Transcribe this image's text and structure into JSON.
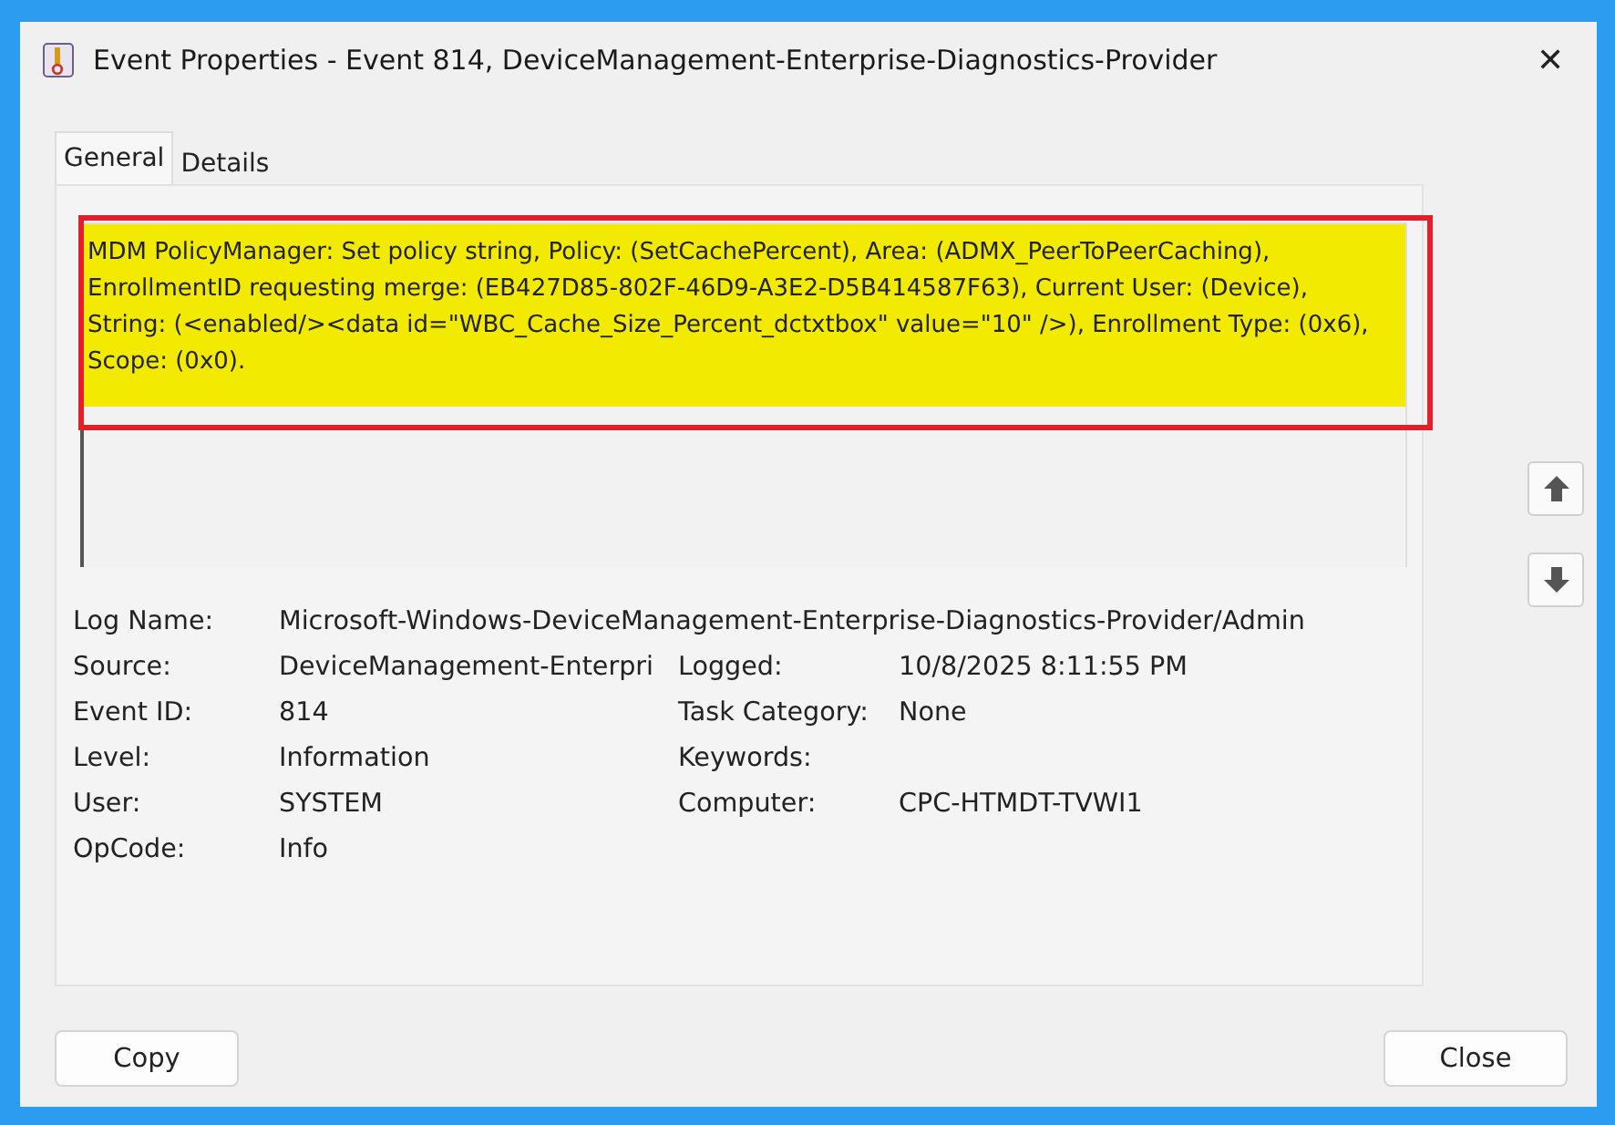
{
  "window": {
    "title": "Event Properties - Event 814, DeviceManagement-Enterprise-Diagnostics-Provider",
    "close": "✕"
  },
  "tabs": [
    {
      "label": "General",
      "selected": true
    },
    {
      "label": "Details",
      "selected": false
    }
  ],
  "message": {
    "text": "MDM PolicyManager: Set policy string, Policy: (SetCachePercent), Area: (ADMX_PeerToPeerCaching), EnrollmentID requesting merge: (EB427D85-802F-46D9-A3E2-D5B414587F63), Current User: (Device), String: (<enabled/><data id=\"WBC_Cache_Size_Percent_dctxtbox\" value=\"10\" />), Enrollment Type: (0x6), Scope: (0x0).",
    "highlighted": true
  },
  "fields": [
    {
      "cells": [
        {
          "label": "Log Name:",
          "value": "Microsoft-Windows-DeviceManagement-Enterprise-Diagnostics-Provider/Admin"
        }
      ]
    },
    {
      "cells": [
        {
          "label": "Source:",
          "value": "DeviceManagement-Enterpri"
        },
        {
          "label": "Logged:",
          "value": "10/8/2025 8:11:55 PM"
        }
      ]
    },
    {
      "cells": [
        {
          "label": "Event ID:",
          "value": "814"
        },
        {
          "label": "Task Category:",
          "value": "None"
        }
      ]
    },
    {
      "cells": [
        {
          "label": "Level:",
          "value": "Information"
        },
        {
          "label": "Keywords:"
        }
      ]
    },
    {
      "cells": [
        {
          "label": "User:",
          "value": "SYSTEM"
        },
        {
          "label": "Computer:",
          "value": "CPC-HTMDT-TVWI1"
        }
      ]
    },
    {
      "cells": [
        {
          "label": "OpCode:",
          "value": "Info"
        }
      ]
    }
  ],
  "buttons": [
    "Copy",
    "Close"
  ]
}
